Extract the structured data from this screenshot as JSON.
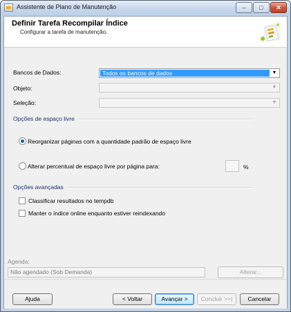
{
  "window": {
    "title": "Assistente de Plano de Manutenção"
  },
  "header": {
    "title": "Definir Tarefa Recompilar Índice",
    "subtitle": "Configurar a tarefa de manutenção."
  },
  "form": {
    "databases_label": "Bancos de Dados:",
    "databases_value": "Todos os bancos de dados",
    "object_label": "Objeto:",
    "object_value": "",
    "selection_label": "Seleção:",
    "selection_value": ""
  },
  "free_space": {
    "group_label": "Opções de espaço livre",
    "option_reorganize": "Reorganizar páginas com a quantidade padrão de espaço livre",
    "option_change_percent": "Alterar percentual de espaço livre por página para:",
    "percent_value": "",
    "percent_unit": "%"
  },
  "advanced": {
    "group_label": "Opções avançadas",
    "sort_in_tempdb": "Classificar resultados no tempdb",
    "keep_online": "Manter o índice online enquanto estiver reindexando"
  },
  "schedule": {
    "label": "Agenda:",
    "value": "Não agendado (Sob Demanda)",
    "change_button": "Alterar..."
  },
  "buttons": {
    "help": "Ajuda",
    "back": "< Voltar",
    "next": "Avançar >",
    "finish": "Concluir >>|",
    "cancel": "Cancelar"
  }
}
